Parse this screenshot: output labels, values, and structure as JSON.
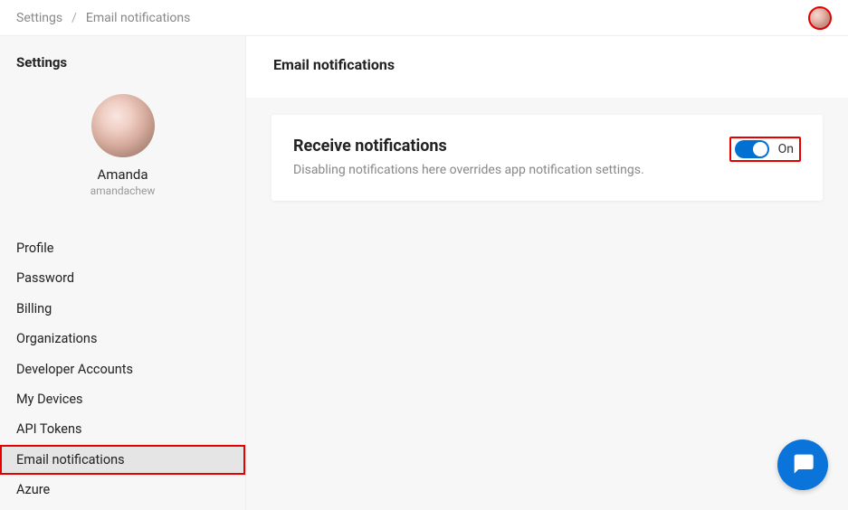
{
  "breadcrumb": {
    "root": "Settings",
    "current": "Email notifications",
    "separator": "/"
  },
  "sidebar": {
    "title": "Settings",
    "profile": {
      "name": "Amanda",
      "handle": "amandachew"
    },
    "items": [
      {
        "label": "Profile",
        "active": false
      },
      {
        "label": "Password",
        "active": false
      },
      {
        "label": "Billing",
        "active": false
      },
      {
        "label": "Organizations",
        "active": false
      },
      {
        "label": "Developer Accounts",
        "active": false
      },
      {
        "label": "My Devices",
        "active": false
      },
      {
        "label": "API Tokens",
        "active": false
      },
      {
        "label": "Email notifications",
        "active": true
      },
      {
        "label": "Azure",
        "active": false
      }
    ]
  },
  "content": {
    "title": "Email notifications",
    "card": {
      "title": "Receive notifications",
      "subtitle": "Disabling notifications here overrides app notification settings.",
      "toggle_label": "On",
      "toggle_on": true
    }
  },
  "icons": {
    "chat": "chat-icon",
    "avatar": "avatar-icon"
  },
  "colors": {
    "accent": "#0070d2",
    "highlight": "#e60000",
    "muted_bg": "#f7f7f7"
  }
}
